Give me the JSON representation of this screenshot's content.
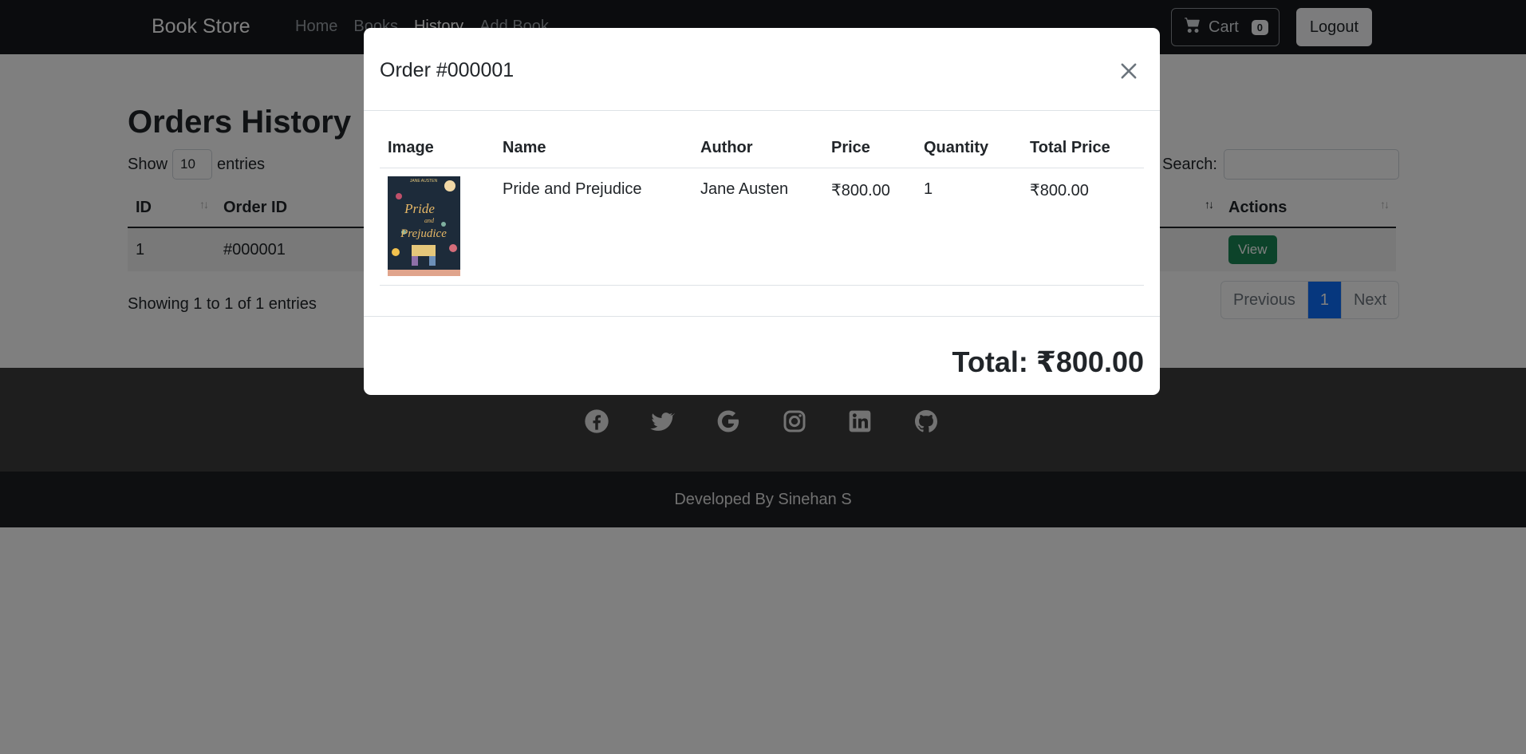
{
  "navbar": {
    "brand": "Book Store",
    "links": [
      "Home",
      "Books",
      "History",
      "Add Book"
    ],
    "active_link": "History",
    "cart_label": "Cart",
    "cart_count": "0",
    "logout_label": "Logout"
  },
  "page": {
    "title": "Orders History",
    "show_label": "Show",
    "entries_label": "entries",
    "page_length": "10",
    "search_label": "Search:",
    "search_value": "",
    "columns": [
      "ID",
      "Order ID",
      "Actions"
    ],
    "rows": [
      {
        "id": "1",
        "order_id": "#000001",
        "action": "View"
      }
    ],
    "showing_text": "Showing 1 to 1 of 1 entries",
    "pagination": {
      "previous": "Previous",
      "current": "1",
      "next": "Next"
    }
  },
  "footer": {
    "social_icons": [
      "facebook-icon",
      "twitter-icon",
      "google-icon",
      "instagram-icon",
      "linkedin-icon",
      "github-icon"
    ],
    "credit": "Developed By Sinehan S"
  },
  "modal": {
    "title": "Order #000001",
    "columns": [
      "Image",
      "Name",
      "Author",
      "Price",
      "Quantity",
      "Total Price"
    ],
    "items": [
      {
        "cover_title_line1": "Pride",
        "cover_title_line2": "and",
        "cover_title_line3": "Prejudice",
        "cover_author": "JANE AUSTEN",
        "name": "Pride and Prejudice",
        "author": "Jane Austen",
        "price": "₹800.00",
        "quantity": "1",
        "total_price": "₹800.00"
      }
    ],
    "total": "Total: ₹800.00"
  },
  "colors": {
    "navbar": "#16181c",
    "primary": "#0d6efd",
    "success": "#198754",
    "footer_social": "#3d3d3d",
    "footer_bottom": "#1d1f23"
  }
}
